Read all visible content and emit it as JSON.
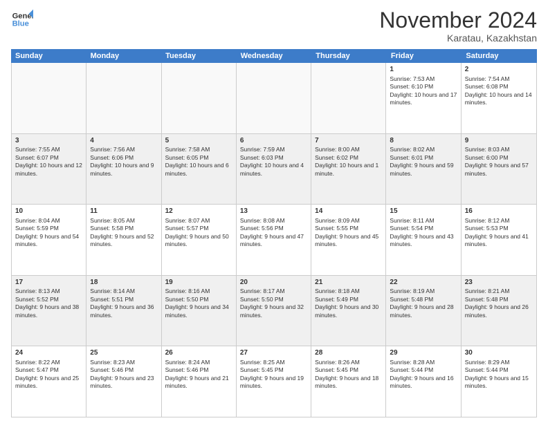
{
  "logo": {
    "line1": "General",
    "line2": "Blue"
  },
  "title": "November 2024",
  "location": "Karatau, Kazakhstan",
  "days_of_week": [
    "Sunday",
    "Monday",
    "Tuesday",
    "Wednesday",
    "Thursday",
    "Friday",
    "Saturday"
  ],
  "weeks": [
    [
      {
        "day": "",
        "info": ""
      },
      {
        "day": "",
        "info": ""
      },
      {
        "day": "",
        "info": ""
      },
      {
        "day": "",
        "info": ""
      },
      {
        "day": "",
        "info": ""
      },
      {
        "day": "1",
        "info": "Sunrise: 7:53 AM\nSunset: 6:10 PM\nDaylight: 10 hours and 17 minutes."
      },
      {
        "day": "2",
        "info": "Sunrise: 7:54 AM\nSunset: 6:08 PM\nDaylight: 10 hours and 14 minutes."
      }
    ],
    [
      {
        "day": "3",
        "info": "Sunrise: 7:55 AM\nSunset: 6:07 PM\nDaylight: 10 hours and 12 minutes."
      },
      {
        "day": "4",
        "info": "Sunrise: 7:56 AM\nSunset: 6:06 PM\nDaylight: 10 hours and 9 minutes."
      },
      {
        "day": "5",
        "info": "Sunrise: 7:58 AM\nSunset: 6:05 PM\nDaylight: 10 hours and 6 minutes."
      },
      {
        "day": "6",
        "info": "Sunrise: 7:59 AM\nSunset: 6:03 PM\nDaylight: 10 hours and 4 minutes."
      },
      {
        "day": "7",
        "info": "Sunrise: 8:00 AM\nSunset: 6:02 PM\nDaylight: 10 hours and 1 minute."
      },
      {
        "day": "8",
        "info": "Sunrise: 8:02 AM\nSunset: 6:01 PM\nDaylight: 9 hours and 59 minutes."
      },
      {
        "day": "9",
        "info": "Sunrise: 8:03 AM\nSunset: 6:00 PM\nDaylight: 9 hours and 57 minutes."
      }
    ],
    [
      {
        "day": "10",
        "info": "Sunrise: 8:04 AM\nSunset: 5:59 PM\nDaylight: 9 hours and 54 minutes."
      },
      {
        "day": "11",
        "info": "Sunrise: 8:05 AM\nSunset: 5:58 PM\nDaylight: 9 hours and 52 minutes."
      },
      {
        "day": "12",
        "info": "Sunrise: 8:07 AM\nSunset: 5:57 PM\nDaylight: 9 hours and 50 minutes."
      },
      {
        "day": "13",
        "info": "Sunrise: 8:08 AM\nSunset: 5:56 PM\nDaylight: 9 hours and 47 minutes."
      },
      {
        "day": "14",
        "info": "Sunrise: 8:09 AM\nSunset: 5:55 PM\nDaylight: 9 hours and 45 minutes."
      },
      {
        "day": "15",
        "info": "Sunrise: 8:11 AM\nSunset: 5:54 PM\nDaylight: 9 hours and 43 minutes."
      },
      {
        "day": "16",
        "info": "Sunrise: 8:12 AM\nSunset: 5:53 PM\nDaylight: 9 hours and 41 minutes."
      }
    ],
    [
      {
        "day": "17",
        "info": "Sunrise: 8:13 AM\nSunset: 5:52 PM\nDaylight: 9 hours and 38 minutes."
      },
      {
        "day": "18",
        "info": "Sunrise: 8:14 AM\nSunset: 5:51 PM\nDaylight: 9 hours and 36 minutes."
      },
      {
        "day": "19",
        "info": "Sunrise: 8:16 AM\nSunset: 5:50 PM\nDaylight: 9 hours and 34 minutes."
      },
      {
        "day": "20",
        "info": "Sunrise: 8:17 AM\nSunset: 5:50 PM\nDaylight: 9 hours and 32 minutes."
      },
      {
        "day": "21",
        "info": "Sunrise: 8:18 AM\nSunset: 5:49 PM\nDaylight: 9 hours and 30 minutes."
      },
      {
        "day": "22",
        "info": "Sunrise: 8:19 AM\nSunset: 5:48 PM\nDaylight: 9 hours and 28 minutes."
      },
      {
        "day": "23",
        "info": "Sunrise: 8:21 AM\nSunset: 5:48 PM\nDaylight: 9 hours and 26 minutes."
      }
    ],
    [
      {
        "day": "24",
        "info": "Sunrise: 8:22 AM\nSunset: 5:47 PM\nDaylight: 9 hours and 25 minutes."
      },
      {
        "day": "25",
        "info": "Sunrise: 8:23 AM\nSunset: 5:46 PM\nDaylight: 9 hours and 23 minutes."
      },
      {
        "day": "26",
        "info": "Sunrise: 8:24 AM\nSunset: 5:46 PM\nDaylight: 9 hours and 21 minutes."
      },
      {
        "day": "27",
        "info": "Sunrise: 8:25 AM\nSunset: 5:45 PM\nDaylight: 9 hours and 19 minutes."
      },
      {
        "day": "28",
        "info": "Sunrise: 8:26 AM\nSunset: 5:45 PM\nDaylight: 9 hours and 18 minutes."
      },
      {
        "day": "29",
        "info": "Sunrise: 8:28 AM\nSunset: 5:44 PM\nDaylight: 9 hours and 16 minutes."
      },
      {
        "day": "30",
        "info": "Sunrise: 8:29 AM\nSunset: 5:44 PM\nDaylight: 9 hours and 15 minutes."
      }
    ]
  ]
}
